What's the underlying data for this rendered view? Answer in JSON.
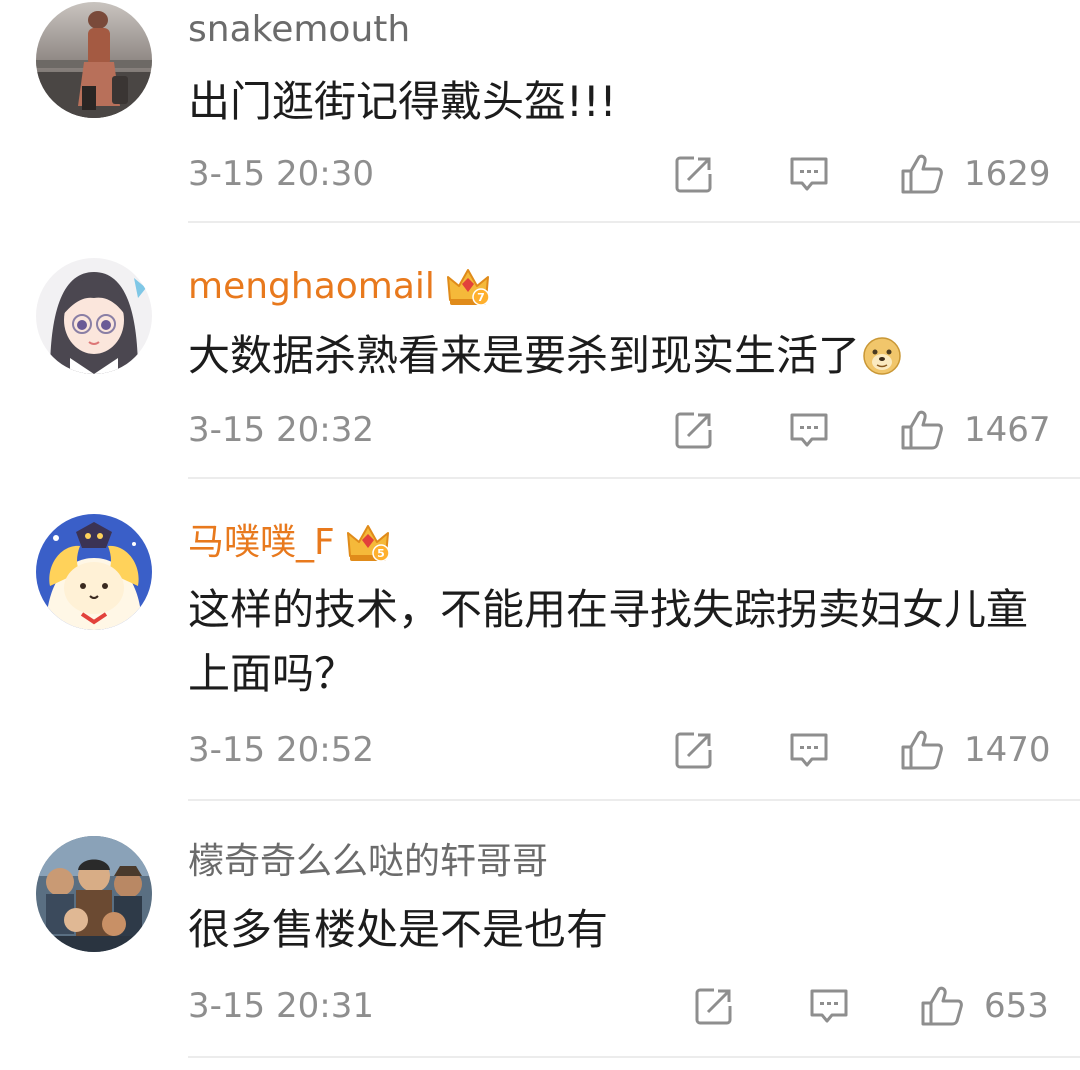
{
  "comments": [
    {
      "username": "snakemouth",
      "vip": false,
      "text": "出门逛街记得戴头盔!!!",
      "emoji": null,
      "time": "3-15 20:30",
      "likes": "1629",
      "avatar_icon": "user-avatar-photo"
    },
    {
      "username": "menghaomail",
      "vip": true,
      "vip_level": "7",
      "text": "大数据杀熟看来是要杀到现实生活了",
      "emoji": "doge-emoji",
      "time": "3-15 20:32",
      "likes": "1467",
      "avatar_icon": "anime-girl-avatar"
    },
    {
      "username": "马噗噗_F",
      "vip": true,
      "vip_level": "5",
      "text": "这样的技术，不能用在寻找失踪拐卖妇女儿童上面吗？",
      "emoji": null,
      "time": "3-15 20:52",
      "likes": "1470",
      "avatar_icon": "cartoon-avatar"
    },
    {
      "username": "檬奇奇么么哒的轩哥哥",
      "vip": false,
      "text": "很多售楼处是不是也有",
      "emoji": null,
      "time": "3-15 20:31",
      "likes": "653",
      "avatar_icon": "group-avatar"
    }
  ],
  "colors": {
    "username_plain": "#6b6b6b",
    "username_vip": "#e8791d",
    "text": "#1c1c1c",
    "meta": "#8e8e8e",
    "divider": "#ececec"
  }
}
